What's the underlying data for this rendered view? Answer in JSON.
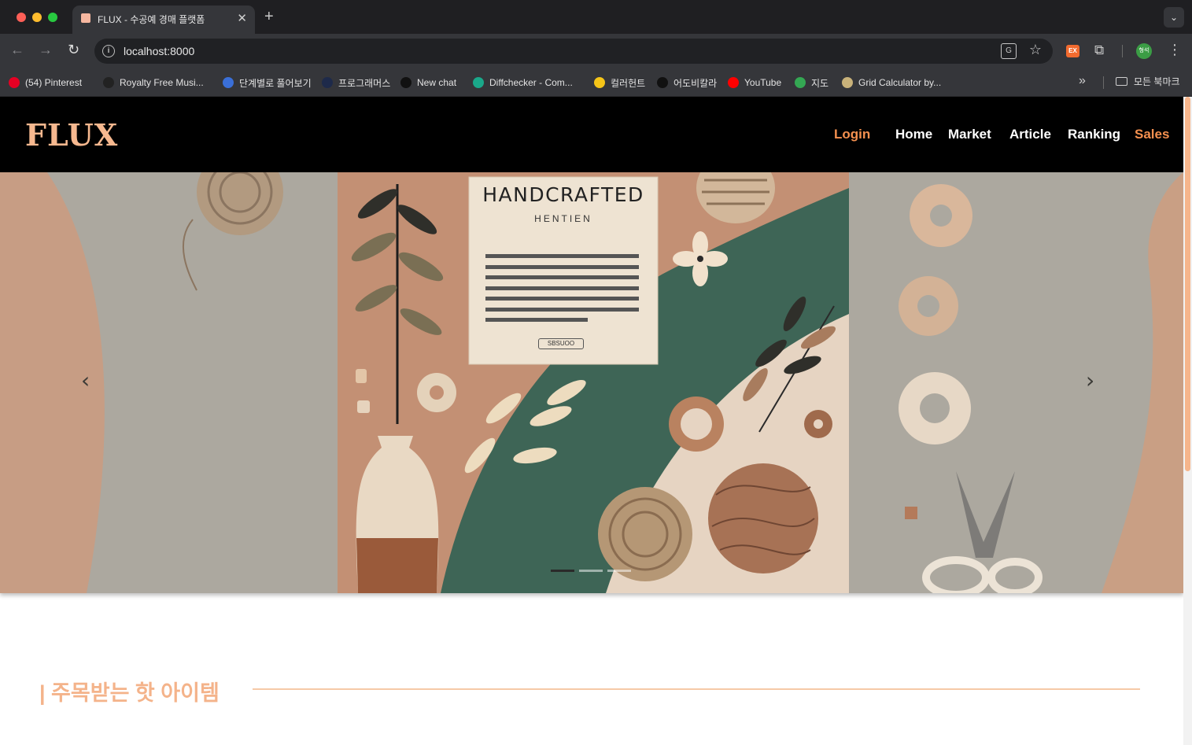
{
  "browser": {
    "tab_title": "FLUX - 수공예 경매 플랫폼",
    "tab_close": "✕",
    "new_tab": "+",
    "url": "localhost:8000",
    "bookmarks": [
      {
        "label": "(54) Pinterest",
        "icon": "pinterest-icon",
        "color": "#e60023"
      },
      {
        "label": "Royalty Free Musi...",
        "icon": "bensound-icon",
        "color": "#222222"
      },
      {
        "label": "단계별로 풀어보기",
        "icon": "code-icon",
        "color": "#3a6fd8"
      },
      {
        "label": "프로그래머스",
        "icon": "programmers-icon",
        "color": "#1e2a4a"
      },
      {
        "label": "New chat",
        "icon": "openai-icon",
        "color": "#111111"
      },
      {
        "label": "Diffchecker - Com...",
        "icon": "diffchecker-icon",
        "color": "#1aa88a"
      },
      {
        "label": "컬러헌트",
        "icon": "colorhunt-icon",
        "color": "#f5c518"
      },
      {
        "label": "어도비칼라",
        "icon": "adobe-color-icon",
        "color": "#111111"
      },
      {
        "label": "YouTube",
        "icon": "youtube-icon",
        "color": "#ff0000"
      },
      {
        "label": "지도",
        "icon": "maps-icon",
        "color": "#34a853"
      },
      {
        "label": "Grid Calculator by...",
        "icon": "grid-icon",
        "color": "#c9b27a"
      }
    ],
    "bookmarks_more": "»",
    "all_bookmarks": "모든 북마크",
    "profile_initials": "형석",
    "extension_label": "EX"
  },
  "site": {
    "logo": "FLUX",
    "nav": {
      "login": "Login",
      "home": "Home",
      "market": "Market",
      "article": "Article",
      "ranking": "Ranking",
      "sales": "Sales"
    },
    "hero": {
      "poster_title": "HANDCRAFTED",
      "poster_subtitle": "HENTIEN",
      "poster_button": "SBSUOO",
      "prev": "‹",
      "next": "›",
      "slide_count": 3,
      "active_slide": 1
    },
    "section_title": "| 주목받는 핫 아이템"
  },
  "colors": {
    "accent": "#f4904f",
    "logo": "#f6b88f",
    "header_bg": "#000000",
    "section_title": "#f4b38a"
  }
}
